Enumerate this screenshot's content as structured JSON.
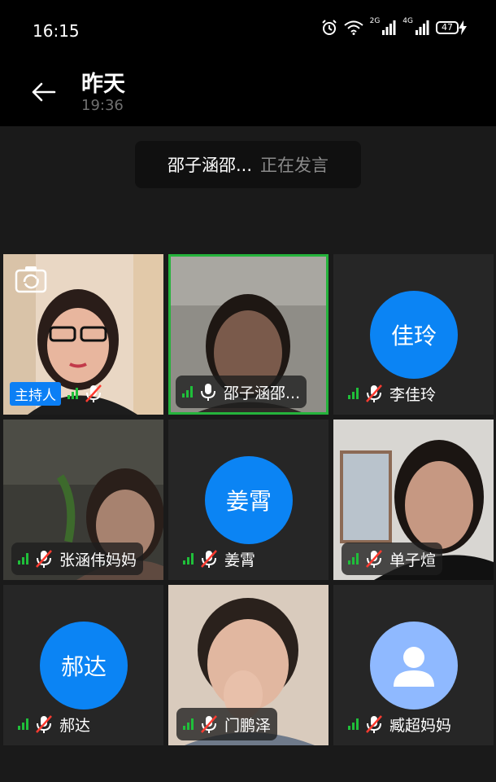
{
  "status_bar": {
    "time": "16:15",
    "net1": "2G",
    "net2": "4G",
    "battery": "47"
  },
  "header": {
    "title": "昨天",
    "subtitle": "19:36"
  },
  "speaker": {
    "name": "邵子涵邵...",
    "status": "正在发言"
  },
  "host_label": "主持人",
  "participants": [
    {
      "name": "",
      "avatar": "",
      "mic": "muted"
    },
    {
      "name": "邵子涵邵...",
      "avatar": "",
      "mic": "on"
    },
    {
      "name": "李佳玲",
      "avatar": "佳玲",
      "mic": "muted"
    },
    {
      "name": "张涵伟妈妈",
      "avatar": "",
      "mic": "muted"
    },
    {
      "name": "姜霄",
      "avatar": "姜霄",
      "mic": "muted"
    },
    {
      "name": "单子煊",
      "avatar": "",
      "mic": "muted"
    },
    {
      "name": "郝达",
      "avatar": "郝达",
      "mic": "muted"
    },
    {
      "name": "门鹏泽",
      "avatar": "",
      "mic": "muted"
    },
    {
      "name": "臧超妈妈",
      "avatar": "user-silhouette-icon",
      "mic": "muted"
    }
  ],
  "colors": {
    "accent": "#0b84f4",
    "signal": "#1fbf3a",
    "active_border": "#25b33c",
    "mute_red": "#ff3b30"
  }
}
